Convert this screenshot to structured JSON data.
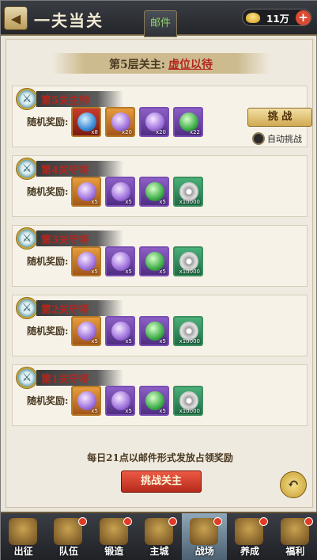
{
  "header": {
    "title": "一夫当关",
    "mail_tab": "邮件",
    "currency_value": "11万",
    "plus_label": "+"
  },
  "banner": {
    "prefix": "第5层关主:",
    "boss": "虚位以待"
  },
  "cards": [
    {
      "title": "第5关主帅",
      "reward_label": "随机奖励:",
      "items": [
        {
          "icon": "blue-orb",
          "count": "x8"
        },
        {
          "icon": "purple-orb",
          "count": "x20"
        },
        {
          "icon": "blue-gem",
          "count": "x20"
        },
        {
          "icon": "green-leaf",
          "count": "x22"
        }
      ]
    },
    {
      "title": "第4关守将",
      "reward_label": "随机奖励:",
      "items": [
        {
          "icon": "purple-orb",
          "count": "x5"
        },
        {
          "icon": "blue-gem",
          "count": "x5"
        },
        {
          "icon": "green-leaf",
          "count": "x5"
        },
        {
          "icon": "silver-coin",
          "count": "x10000"
        }
      ]
    },
    {
      "title": "第3关守将",
      "reward_label": "随机奖励:",
      "items": [
        {
          "icon": "purple-orb",
          "count": "x5"
        },
        {
          "icon": "blue-gem",
          "count": "x5"
        },
        {
          "icon": "green-leaf",
          "count": "x5"
        },
        {
          "icon": "silver-coin",
          "count": "x10000"
        }
      ]
    },
    {
      "title": "第2关守将",
      "reward_label": "随机奖励:",
      "items": [
        {
          "icon": "purple-orb",
          "count": "x5"
        },
        {
          "icon": "blue-gem",
          "count": "x5"
        },
        {
          "icon": "green-leaf",
          "count": "x5"
        },
        {
          "icon": "silver-coin",
          "count": "x10000"
        }
      ]
    },
    {
      "title": "第1关守将",
      "reward_label": "随机奖励:",
      "items": [
        {
          "icon": "purple-orb",
          "count": "x5"
        },
        {
          "icon": "blue-gem",
          "count": "x5"
        },
        {
          "icon": "green-leaf",
          "count": "x5"
        },
        {
          "icon": "silver-coin",
          "count": "x10000"
        }
      ]
    }
  ],
  "challenge_button": "挑 战",
  "auto_challenge": "自动挑战",
  "notice": "每日21点以邮件形式发放占领奖励",
  "boss_button": "挑战关主",
  "nav": [
    {
      "label": "出征",
      "badge": false
    },
    {
      "label": "队伍",
      "badge": true
    },
    {
      "label": "锻造",
      "badge": true
    },
    {
      "label": "主城",
      "badge": true
    },
    {
      "label": "战场",
      "badge": true,
      "active": true
    },
    {
      "label": "养成",
      "badge": true
    },
    {
      "label": "福利",
      "badge": true
    }
  ]
}
